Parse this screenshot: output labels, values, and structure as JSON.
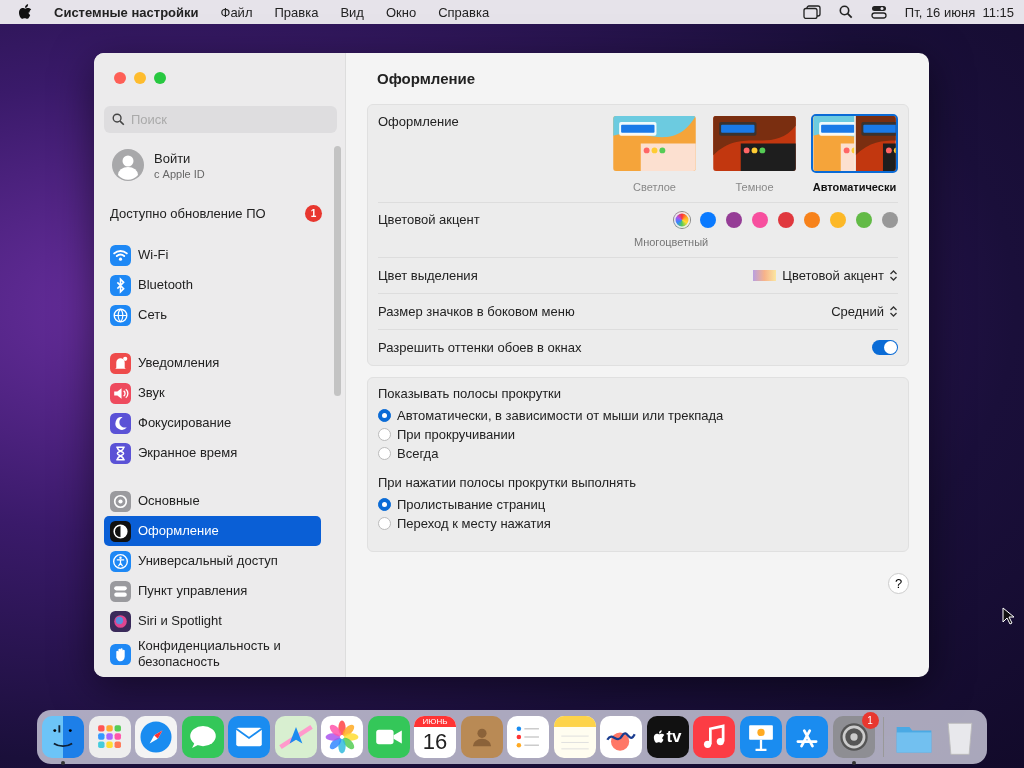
{
  "menubar": {
    "app_name": "Системные настройки",
    "menus": [
      "Файл",
      "Правка",
      "Вид",
      "Окно",
      "Справка"
    ],
    "clock": "Пт, 16 июня  11:15"
  },
  "sidebar": {
    "search": {
      "placeholder": "Поиск"
    },
    "account": {
      "title": "Войти",
      "subtitle": "с Apple ID"
    },
    "update": {
      "label": "Доступно обновление ПО",
      "badge": "1"
    },
    "groups": [
      [
        {
          "label": "Wi-Fi",
          "selected": false
        },
        {
          "label": "Bluetooth",
          "selected": false
        },
        {
          "label": "Сеть",
          "selected": false
        }
      ],
      [
        {
          "label": "Уведомления",
          "selected": false
        },
        {
          "label": "Звук",
          "selected": false
        },
        {
          "label": "Фокусирование",
          "selected": false
        },
        {
          "label": "Экранное время",
          "selected": false
        }
      ],
      [
        {
          "label": "Основные",
          "selected": false
        },
        {
          "label": "Оформление",
          "selected": true
        },
        {
          "label": "Универсальный доступ",
          "selected": false
        },
        {
          "label": "Пункт управления",
          "selected": false
        },
        {
          "label": "Siri и Spotlight",
          "selected": false
        },
        {
          "label": "Конфиденциальность и безопасность",
          "selected": false
        }
      ]
    ]
  },
  "content": {
    "title": "Оформление",
    "rows": [
      {
        "kind": "appearance",
        "label": "Оформление",
        "options": [
          {
            "label": "Светлое",
            "selected": false
          },
          {
            "label": "Темное",
            "selected": false
          },
          {
            "label": "Автоматически",
            "selected": true
          }
        ]
      },
      {
        "kind": "accent",
        "label": "Цветовой акцент",
        "caption": "Многоцветный",
        "colors": [
          {
            "kind": "multicolor",
            "selected": true
          },
          {
            "kind": "solid",
            "color": "#0a7aff",
            "selected": false
          },
          {
            "kind": "solid",
            "color": "#953d96",
            "selected": false
          },
          {
            "kind": "solid",
            "color": "#f74f9e",
            "selected": false
          },
          {
            "kind": "solid",
            "color": "#e0383e",
            "selected": false
          },
          {
            "kind": "solid",
            "color": "#f7821b",
            "selected": false
          },
          {
            "kind": "solid",
            "color": "#fcb827",
            "selected": false
          },
          {
            "kind": "solid",
            "color": "#62ba46",
            "selected": false
          },
          {
            "kind": "solid",
            "color": "#989898",
            "selected": false
          }
        ]
      },
      {
        "kind": "popup",
        "label": "Цвет выделения",
        "value": "Цветовой акцент",
        "swatch": true
      },
      {
        "kind": "popup",
        "label": "Размер значков в боковом меню",
        "value": "Средний",
        "swatch": false
      },
      {
        "kind": "toggle",
        "label": "Разрешить оттенки обоев в окнах",
        "on": true
      }
    ],
    "radio_groups": [
      {
        "title": "Показывать полосы прокрутки",
        "options": [
          {
            "label": "Автоматически, в зависимости от мыши или трекпада",
            "selected": true
          },
          {
            "label": "При прокручивании",
            "selected": false
          },
          {
            "label": "Всегда",
            "selected": false
          }
        ]
      },
      {
        "title": "При нажатии полосы прокрутки выполнять",
        "options": [
          {
            "label": "Пролистывание страниц",
            "selected": true
          },
          {
            "label": "Переход к месту нажатия",
            "selected": false
          }
        ]
      }
    ],
    "help": "?"
  },
  "dock": [
    {
      "running": true
    },
    {
      "running": false
    },
    {
      "running": false
    },
    {
      "running": false
    },
    {
      "running": false
    },
    {
      "running": false
    },
    {
      "running": false
    },
    {
      "running": false
    },
    {
      "running": false,
      "month": "ИЮНЬ",
      "day": "16"
    },
    {
      "running": false
    },
    {
      "running": false
    },
    {
      "running": false
    },
    {
      "running": false
    },
    {
      "running": false,
      "text": "tv"
    },
    {
      "running": false
    },
    {
      "running": false
    },
    {
      "running": false
    },
    {
      "running": true,
      "badge": "1"
    },
    {
      "separator": true
    },
    {
      "running": false
    },
    {
      "running": false
    }
  ]
}
